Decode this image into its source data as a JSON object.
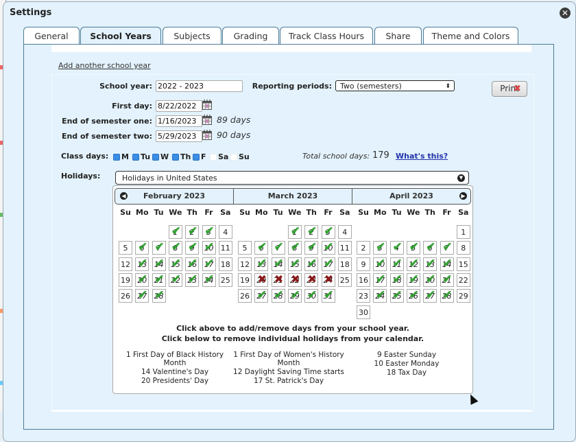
{
  "dialog": {
    "title": "Settings",
    "close_icon": "close-circle-icon"
  },
  "tabs": [
    {
      "label": "General",
      "active": false
    },
    {
      "label": "School Years",
      "active": true
    },
    {
      "label": "Subjects",
      "active": false
    },
    {
      "label": "Grading",
      "active": false
    },
    {
      "label": "Track Class Hours",
      "active": false
    },
    {
      "label": "Share",
      "active": false
    },
    {
      "label": "Theme and Colors",
      "active": false
    }
  ],
  "add_school_year_link": "Add another school year",
  "form": {
    "school_year_label": "School year:",
    "school_year_value": "2022 - 2023",
    "reporting_periods_label": "Reporting periods:",
    "reporting_periods_value": "Two (semesters)",
    "first_day_label": "First day:",
    "first_day_value": "8/22/2022",
    "end_sem1_label": "End of semester one:",
    "end_sem1_value": "1/16/2023",
    "end_sem1_days": "89 days",
    "end_sem2_label": "End of semester two:",
    "end_sem2_value": "5/29/2023",
    "end_sem2_days": "90 days",
    "print_label": "Print",
    "class_days_label": "Class days:",
    "class_days": [
      {
        "label": "M",
        "checked": true
      },
      {
        "label": "Tu",
        "checked": true
      },
      {
        "label": "W",
        "checked": true
      },
      {
        "label": "Th",
        "checked": true
      },
      {
        "label": "F",
        "checked": true
      },
      {
        "label": "Sa",
        "checked": false
      },
      {
        "label": "Su",
        "checked": false
      }
    ],
    "total_school_days_label": "Total school days:",
    "total_school_days_value": "179",
    "whats_this_link": "What's this?",
    "holidays_label": "Holidays:",
    "holidays_value": "Holidays in United States"
  },
  "calendar": {
    "weekday_headers": [
      "Su",
      "Mo",
      "Tu",
      "We",
      "Th",
      "Fr",
      "Sa"
    ],
    "months": [
      {
        "title": "February 2023",
        "first_weekday": 3,
        "days_in_month": 28,
        "checked": [
          1,
          2,
          3,
          6,
          7,
          8,
          9,
          10,
          13,
          14,
          15,
          16,
          17,
          20,
          21,
          22,
          23,
          24,
          27,
          28
        ],
        "excluded": [],
        "holidays": [
          "1 First Day of Black History Month",
          "14 Valentine's Day",
          "20 Presidents' Day"
        ]
      },
      {
        "title": "March 2023",
        "first_weekday": 3,
        "days_in_month": 31,
        "checked": [
          1,
          2,
          3,
          6,
          7,
          8,
          9,
          10,
          13,
          14,
          15,
          16,
          17,
          27,
          28,
          29,
          30,
          31
        ],
        "excluded": [
          20,
          21,
          22,
          23,
          24
        ],
        "holidays": [
          "1 First Day of Women's History Month",
          "12 Daylight Saving Time starts",
          "17 St. Patrick's Day"
        ]
      },
      {
        "title": "April 2023",
        "first_weekday": 6,
        "days_in_month": 30,
        "checked": [
          3,
          4,
          5,
          6,
          7,
          10,
          11,
          12,
          13,
          14,
          17,
          18,
          19,
          20,
          21,
          24,
          25,
          26,
          27,
          28
        ],
        "excluded": [],
        "holidays": [
          "9 Easter Sunday",
          "10 Easter Monday",
          "18 Tax Day"
        ]
      }
    ],
    "instruction_1": "Click above to add/remove days from your school year.",
    "instruction_2": "Click below to remove individual holidays from your calendar.",
    "prev_icon": "chevron-left-circle-icon",
    "next_icon": "chevron-right-circle-icon"
  },
  "colors": {
    "background": "#e3f2fc",
    "tab_border": "#4c7a96",
    "check_green": "#2fa52f",
    "excluded_red": "#8b1a1a",
    "link_blue": "#2233aa"
  }
}
